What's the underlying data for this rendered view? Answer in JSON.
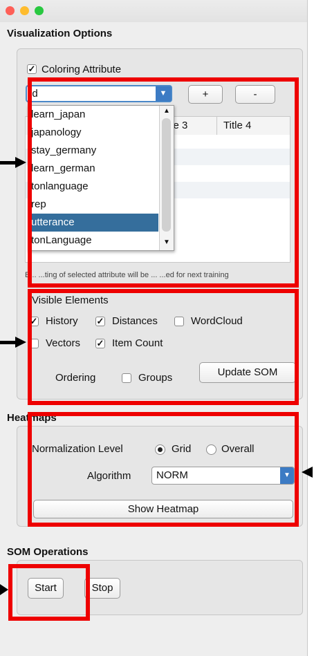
{
  "window_controls": {
    "close_color": "#fe5f57",
    "minimize_color": "#febc2e",
    "maximize_color": "#28c840"
  },
  "visualization": {
    "title": "Visualization Options",
    "coloring_attribute_label": "Coloring Attribute",
    "coloring_attribute_checked": true,
    "selected_attribute": "id",
    "plus_label": "+",
    "minus_label": "-",
    "dropdown_options": [
      "learn_japan",
      "japanology",
      "stay_germany",
      "learn_german",
      "tonlanguage",
      "rep",
      "utterance",
      "tonLanguage"
    ],
    "highlighted_option": "utterance",
    "table_headers": [
      "tle 3",
      "Title 4"
    ],
    "footnote": "E... ...ting of selected attribute will be ... ...ed for next training"
  },
  "visible_elements": {
    "title": "Visible Elements",
    "history_label": "History",
    "history_checked": true,
    "distances_label": "Distances",
    "distances_checked": true,
    "wordcloud_label": "WordCloud",
    "wordcloud_checked": false,
    "vectors_label": "Vectors",
    "vectors_checked": false,
    "item_count_label": "Item Count",
    "item_count_checked": true,
    "ordering_label": "Ordering",
    "groups_label": "Groups",
    "groups_checked": false,
    "update_som_label": "Update SOM"
  },
  "heatmaps": {
    "title": "Heatmaps",
    "normalization_label": "Normalization Level",
    "grid_label": "Grid",
    "overall_label": "Overall",
    "selected_normalization": "Grid",
    "algorithm_label": "Algorithm",
    "algorithm_value": "NORM",
    "show_heatmap_label": "Show Heatmap"
  },
  "som_operations": {
    "title": "SOM Operations",
    "start_label": "Start",
    "stop_label": "Stop"
  },
  "annotation_color": "#ee0000"
}
